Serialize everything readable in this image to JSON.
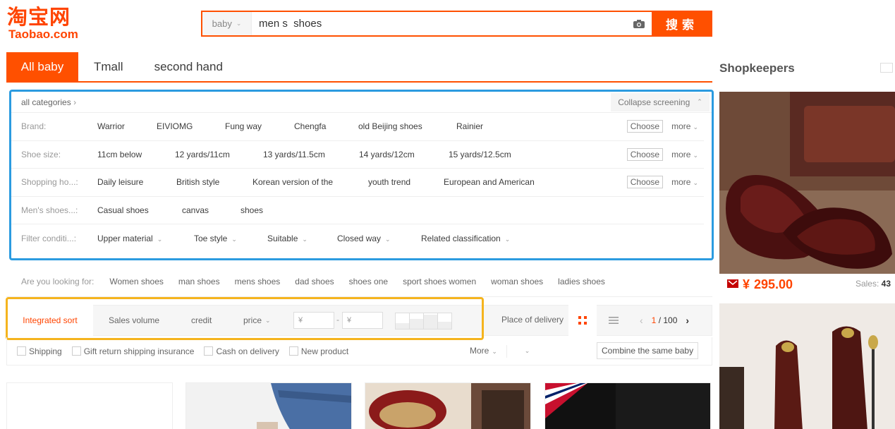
{
  "logo": {
    "cn": "淘宝网",
    "en": "Taobao.com"
  },
  "search": {
    "category": "baby",
    "query": "men s  shoes",
    "button": "搜索"
  },
  "tabs": [
    {
      "label": "All baby",
      "active": true
    },
    {
      "label": "Tmall",
      "active": false
    },
    {
      "label": "second hand",
      "active": false
    }
  ],
  "filter": {
    "all_categories": "all categories",
    "collapse": "Collapse screening",
    "choose": "Choose",
    "more": "more",
    "rows": [
      {
        "label": "Brand:",
        "values": [
          "Warrior",
          "EIVIOMG",
          "Fung way",
          "Chengfa",
          "old Beijing shoes",
          "Rainier"
        ]
      },
      {
        "label": "Shoe size:",
        "values": [
          "11cm below",
          "12 yards/11cm",
          "13 yards/11.5cm",
          "14 yards/12cm",
          "15 yards/12.5cm"
        ]
      },
      {
        "label": "Shopping ho...:",
        "values": [
          "Daily leisure",
          "British style",
          "Korean version of the",
          "youth trend",
          "European and American"
        ]
      },
      {
        "label": "Men's shoes...:",
        "values": [
          "Casual shoes",
          "canvas",
          "shoes"
        ]
      },
      {
        "label": "Filter conditi...:",
        "values": [
          "Upper material",
          "Toe style",
          "Suitable",
          "Closed way",
          "Related classification"
        ]
      }
    ]
  },
  "suggest": {
    "label": "Are you looking for:",
    "items": [
      "Women shoes",
      "man shoes",
      "mens shoes",
      "dad shoes",
      "shoes one",
      "sport shoes women",
      "woman shoes",
      "ladies shoes"
    ]
  },
  "sort": {
    "integrated": "Integrated sort",
    "sales": "Sales volume",
    "credit": "credit",
    "price": "price",
    "price_min_placeholder": "¥",
    "price_max_placeholder": "¥",
    "dash": "-",
    "delivery": "Place of delivery",
    "page_current": "1",
    "page_total": "/ 100"
  },
  "options": {
    "shipping": "Shipping",
    "gift": "Gift return shipping insurance",
    "cod": "Cash on delivery",
    "new": "New product",
    "more": "More",
    "combine": "Combine the same baby"
  },
  "sidebar": {
    "title": "Shopkeepers",
    "price_symbol": "¥",
    "price": "295.00",
    "sales_label": "Sales:",
    "sales_value": "43"
  },
  "colors": {
    "brand": "#ff5000",
    "filter_border": "#2b9be0",
    "sort_border": "#f5b41e"
  }
}
